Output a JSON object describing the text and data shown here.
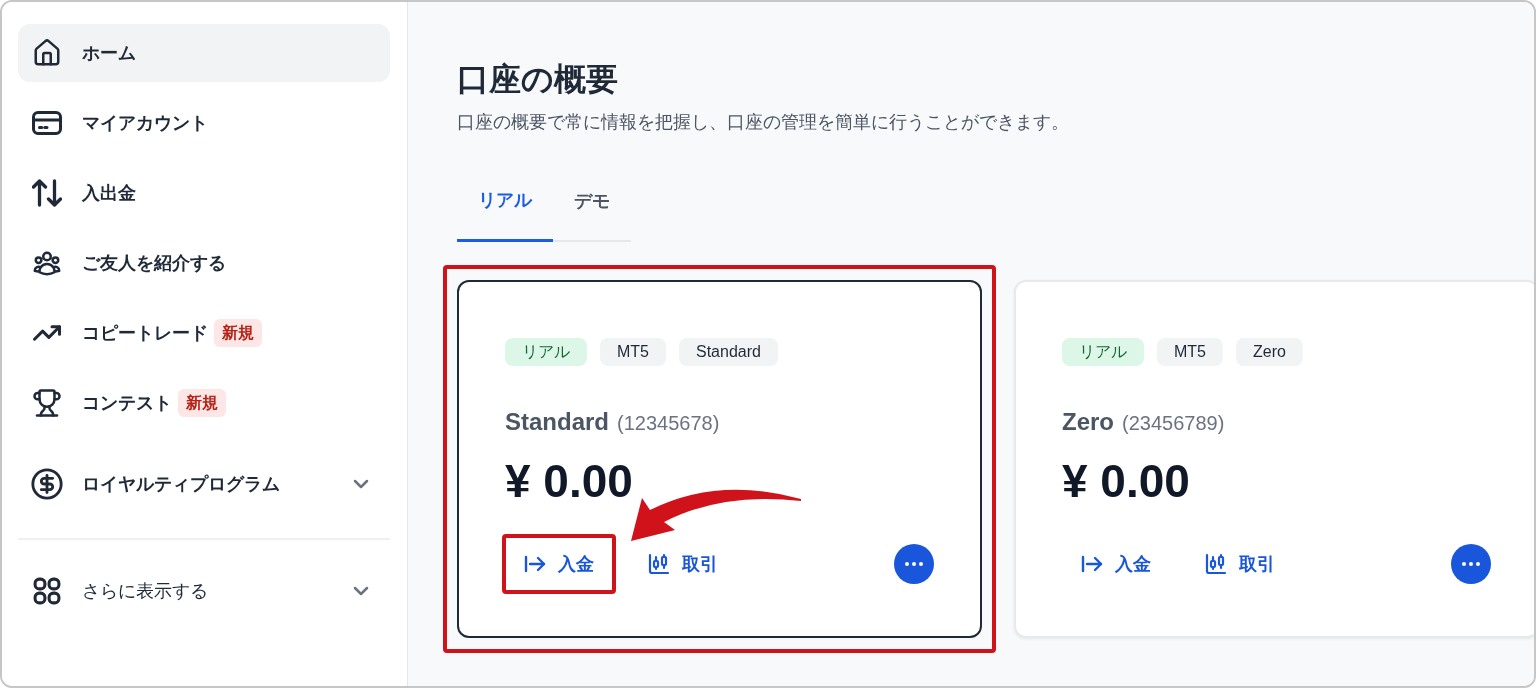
{
  "sidebar": {
    "items": [
      {
        "label": "ホーム",
        "selected": true
      },
      {
        "label": "マイアカウント",
        "selected": false
      },
      {
        "label": "入出金",
        "selected": false
      },
      {
        "label": "ご友人を紹介する",
        "selected": false
      },
      {
        "label": "コピートレード",
        "selected": false,
        "badge": "新規"
      },
      {
        "label": "コンテスト",
        "selected": false,
        "badge": "新規"
      },
      {
        "label": "ロイヤルティプログラム",
        "selected": false,
        "expanded": false
      }
    ],
    "more": {
      "label": "さらに表示する",
      "expanded": false
    }
  },
  "main": {
    "title": "口座の概要",
    "subtitle": "口座の概要で常に情報を把握し、口座の管理を簡単に行うことができます。",
    "tabs": [
      {
        "label": "リアル",
        "selected": true
      },
      {
        "label": "デモ",
        "selected": false
      }
    ],
    "cards": [
      {
        "selected": true,
        "highlighted": true,
        "tags": [
          {
            "label": "リアル",
            "kind": "status"
          },
          {
            "label": "MT5",
            "kind": "spec"
          },
          {
            "label": "Standard",
            "kind": "spec"
          }
        ],
        "name": "Standard",
        "number": "(12345678)",
        "balance": "¥ 0.00",
        "actions": [
          {
            "label": "入金",
            "kind": "deposit",
            "highlighted": true
          },
          {
            "label": "取引",
            "kind": "trade",
            "highlighted": false
          }
        ]
      },
      {
        "selected": false,
        "highlighted": false,
        "tags": [
          {
            "label": "リアル",
            "kind": "status"
          },
          {
            "label": "MT5",
            "kind": "spec"
          },
          {
            "label": "Zero",
            "kind": "spec"
          }
        ],
        "name": "Zero",
        "number": "(23456789)",
        "balance": "¥ 0.00",
        "actions": [
          {
            "label": "入金",
            "kind": "deposit",
            "highlighted": false
          },
          {
            "label": "取引",
            "kind": "trade",
            "highlighted": false
          }
        ]
      }
    ]
  }
}
